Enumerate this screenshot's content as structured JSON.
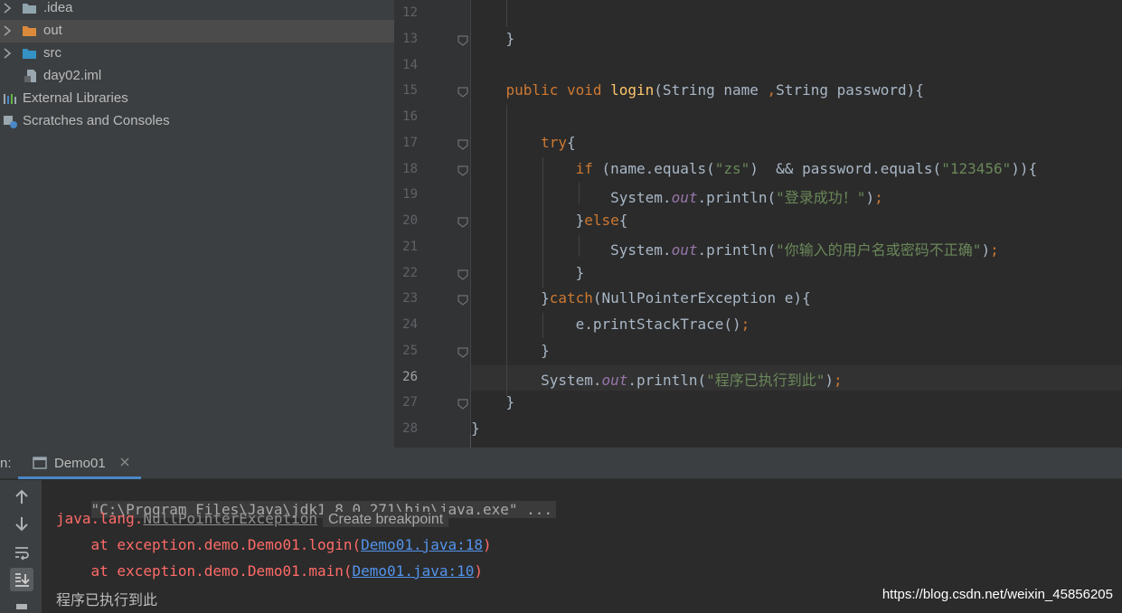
{
  "project_tree": {
    "items": [
      {
        "label": ".idea",
        "icon": "folder-icon",
        "color": "#90a4ae"
      },
      {
        "label": "out",
        "icon": "folder-icon",
        "color": "#db8a3b",
        "selected": true
      },
      {
        "label": "src",
        "icon": "folder-icon",
        "color": "#3592c4"
      },
      {
        "label": "day02.iml",
        "icon": "module-file-icon"
      },
      {
        "label": "External Libraries",
        "icon": "libraries-icon"
      },
      {
        "label": "Scratches and Consoles",
        "icon": "scratches-icon"
      }
    ]
  },
  "editor": {
    "current_line": "26",
    "lines": [
      {
        "n": "12",
        "t": [
          {
            "c": "pl",
            "s": ""
          }
        ]
      },
      {
        "n": "13",
        "t": [
          {
            "c": "pl",
            "s": "    }"
          }
        ]
      },
      {
        "n": "14",
        "t": [
          {
            "c": "pl",
            "s": ""
          }
        ]
      },
      {
        "n": "15",
        "t": [
          {
            "c": "kw",
            "s": "    public void "
          },
          {
            "c": "fn",
            "s": "login"
          },
          {
            "c": "pl",
            "s": "(String name "
          },
          {
            "c": "kw",
            "s": ","
          },
          {
            "c": "pl",
            "s": "String password){"
          }
        ]
      },
      {
        "n": "16",
        "t": [
          {
            "c": "pl",
            "s": ""
          }
        ]
      },
      {
        "n": "17",
        "t": [
          {
            "c": "kw",
            "s": "        try"
          },
          {
            "c": "pl",
            "s": "{"
          }
        ]
      },
      {
        "n": "18",
        "t": [
          {
            "c": "kw",
            "s": "            if "
          },
          {
            "c": "pl",
            "s": "(name.equals("
          },
          {
            "c": "str",
            "s": "\"zs\""
          },
          {
            "c": "pl",
            "s": ")  && password.equals("
          },
          {
            "c": "str",
            "s": "\"123456\""
          },
          {
            "c": "pl",
            "s": ")){"
          }
        ]
      },
      {
        "n": "19",
        "t": [
          {
            "c": "pl",
            "s": "                System."
          },
          {
            "c": "st",
            "s": "out"
          },
          {
            "c": "pl",
            "s": ".println("
          },
          {
            "c": "str",
            "s": "\"登录成功！\""
          },
          {
            "c": "pl",
            "s": ")"
          },
          {
            "c": "kw",
            "s": ";"
          }
        ]
      },
      {
        "n": "20",
        "t": [
          {
            "c": "pl",
            "s": "            }"
          },
          {
            "c": "kw",
            "s": "else"
          },
          {
            "c": "pl",
            "s": "{"
          }
        ]
      },
      {
        "n": "21",
        "t": [
          {
            "c": "pl",
            "s": "                System."
          },
          {
            "c": "st",
            "s": "out"
          },
          {
            "c": "pl",
            "s": ".println("
          },
          {
            "c": "str",
            "s": "\"你输入的用户名或密码不正确\""
          },
          {
            "c": "pl",
            "s": ")"
          },
          {
            "c": "kw",
            "s": ";"
          }
        ]
      },
      {
        "n": "22",
        "t": [
          {
            "c": "pl",
            "s": "            }"
          }
        ]
      },
      {
        "n": "23",
        "t": [
          {
            "c": "pl",
            "s": "        }"
          },
          {
            "c": "kw",
            "s": "catch"
          },
          {
            "c": "pl",
            "s": "(NullPointerException e){"
          }
        ]
      },
      {
        "n": "24",
        "t": [
          {
            "c": "pl",
            "s": "            e.printStackTrace()"
          },
          {
            "c": "kw",
            "s": ";"
          }
        ]
      },
      {
        "n": "25",
        "t": [
          {
            "c": "pl",
            "s": "        }"
          }
        ]
      },
      {
        "n": "26",
        "t": [
          {
            "c": "pl",
            "s": "        System."
          },
          {
            "c": "st",
            "s": "out"
          },
          {
            "c": "pl",
            "s": ".println("
          },
          {
            "c": "str",
            "s": "\"程序已执行到此\""
          },
          {
            "c": "pl",
            "s": ")"
          },
          {
            "c": "kw",
            "s": ";"
          }
        ]
      },
      {
        "n": "27",
        "t": [
          {
            "c": "pl",
            "s": "    }"
          }
        ]
      },
      {
        "n": "28",
        "t": [
          {
            "c": "pl",
            "s": "}"
          }
        ]
      }
    ]
  },
  "run": {
    "label": "n:",
    "tab_label": "Demo01",
    "console": {
      "command": "\"C:\\Program Files\\Java\\jdk1.8.0_271\\bin\\java.exe\" ...",
      "exception_prefix": "java.lang.",
      "exception_name": "NullPointerException",
      "breakpoint_hint": "Create breakpoint",
      "trace": [
        {
          "prefix": "    at exception.demo.Demo01.login(",
          "link": "Demo01.java:18",
          "suffix": ")"
        },
        {
          "prefix": "    at exception.demo.Demo01.main(",
          "link": "Demo01.java:10",
          "suffix": ")"
        }
      ],
      "output": "程序已执行到此"
    }
  },
  "watermark": "https://blog.csdn.net/weixin_45856205"
}
